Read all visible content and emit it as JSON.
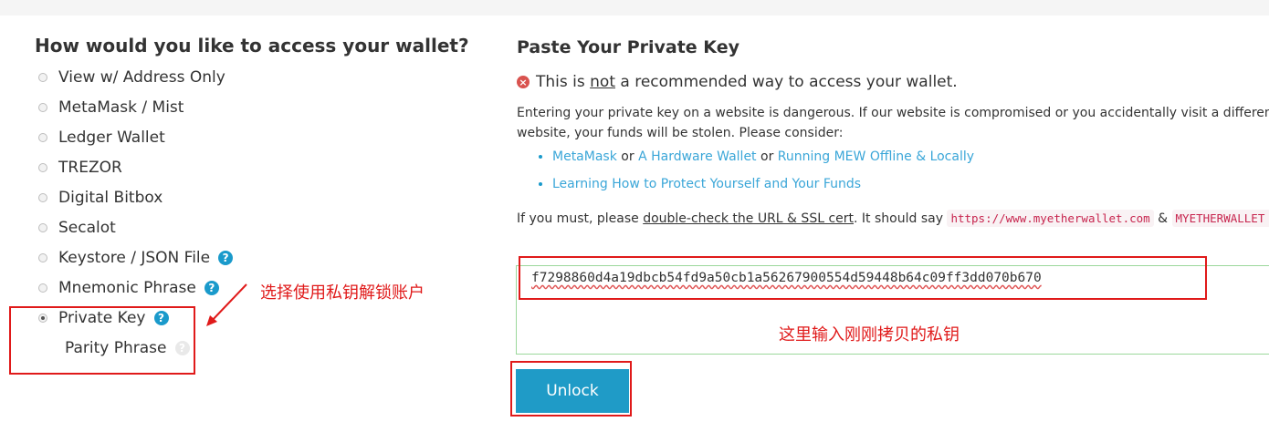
{
  "access": {
    "title": "How would you like to access your wallet?",
    "options": [
      {
        "label": "View w/ Address Only",
        "help": false,
        "selected": false
      },
      {
        "label": "MetaMask / Mist",
        "help": false,
        "selected": false
      },
      {
        "label": "Ledger Wallet",
        "help": false,
        "selected": false
      },
      {
        "label": "TREZOR",
        "help": false,
        "selected": false
      },
      {
        "label": "Digital Bitbox",
        "help": false,
        "selected": false
      },
      {
        "label": "Secalot",
        "help": false,
        "selected": false
      },
      {
        "label": "Keystore / JSON File",
        "help": true,
        "selected": false
      },
      {
        "label": "Mnemonic Phrase",
        "help": true,
        "selected": false
      },
      {
        "label": "Private Key",
        "help": true,
        "selected": true
      }
    ],
    "sub_option": "Parity Phrase",
    "help_glyph": "?"
  },
  "annotations": {
    "select_note": "选择使用私钥解锁账户",
    "paste_note": "这里输入刚刚拷贝的私钥",
    "color": "#e01a1a"
  },
  "panel": {
    "title": "Paste Your Private Key",
    "warning_pre": "This is ",
    "warning_em": "not",
    "warning_post": " a recommended way to access your wallet.",
    "warning_icon": "×",
    "body": "Entering your private key on a website is dangerous. If our website is compromised or you accidentally visit a different website, your funds will be stolen. Please consider:",
    "link_metamask": "MetaMask",
    "or1": " or ",
    "link_hardware": "A Hardware Wallet",
    "or2": " or ",
    "link_offline": "Running MEW Offline & Locally",
    "link_protect": "Learning How to Protect Yourself and Your Funds",
    "must_pre": "If you must, please ",
    "must_link": "double-check the URL & SSL cert",
    "must_post": ". It should say ",
    "url_code": "https://www.myetherwallet.com",
    "amp": " & ",
    "brand_code": "MYETHERWALLET INC",
    "private_key_value": "f7298860d4a19dbcb54fd9a50cb1a56267900554d59448b64c09ff3dd070b670",
    "unlock_label": "Unlock"
  },
  "colors": {
    "accent": "#1f9bc7",
    "link": "#3aa6d8",
    "danger": "#d9534f",
    "input_border": "#9bd89b"
  }
}
